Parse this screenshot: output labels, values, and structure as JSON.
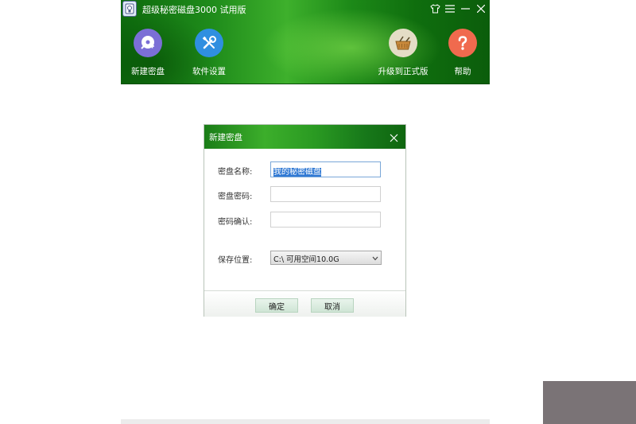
{
  "window": {
    "title": "超级秘密磁盘3000 试用版"
  },
  "toolbar": {
    "new_disk_label": "新建密盘",
    "settings_label": "软件设置",
    "upgrade_label": "升级到正式版",
    "help_label": "帮助"
  },
  "dialog": {
    "title": "新建密盘",
    "name_label": "密盘名称:",
    "name_value": "我的秘密磁盘",
    "password_label": "密盘密码:",
    "password_value": "",
    "confirm_label": "密码确认:",
    "confirm_value": "",
    "location_label": "保存位置:",
    "location_value": "C:\\ 可用空间10.0G",
    "ok_label": "确定",
    "cancel_label": "取消"
  },
  "colors": {
    "header_green": "#1f8c1b",
    "selection_blue": "#3079d4",
    "new_disk_icon_bg": "#7b6fd6",
    "settings_icon_bg": "#2f8fe0",
    "upgrade_icon_bg": "#e4ddc6",
    "help_icon_bg": "#f06a4e"
  }
}
